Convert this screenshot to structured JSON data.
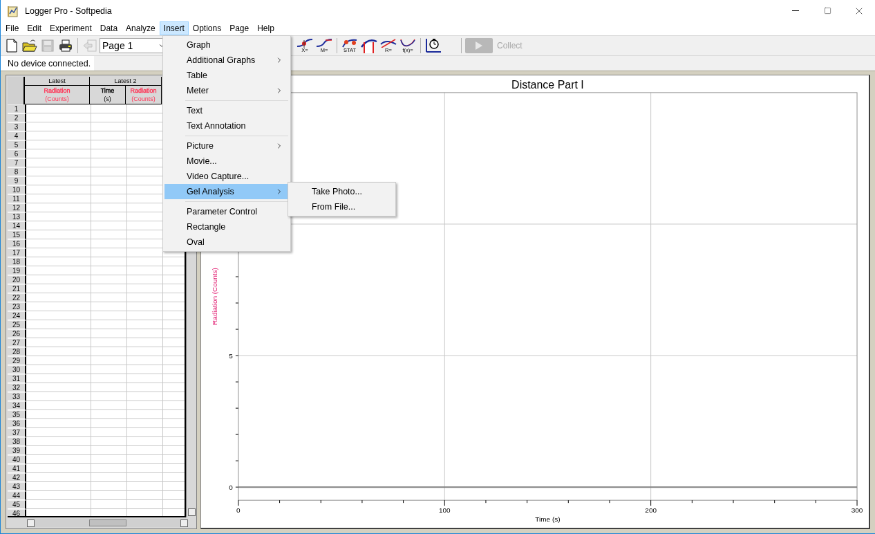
{
  "window": {
    "title": "Logger Pro - Softpedia"
  },
  "menu_bar": [
    {
      "label": "File",
      "selected": false
    },
    {
      "label": "Edit",
      "selected": false
    },
    {
      "label": "Experiment",
      "selected": false
    },
    {
      "label": "Data",
      "selected": false
    },
    {
      "label": "Analyze",
      "selected": false
    },
    {
      "label": "Insert",
      "selected": true
    },
    {
      "label": "Options",
      "selected": false
    },
    {
      "label": "Page",
      "selected": false
    },
    {
      "label": "Help",
      "selected": false
    }
  ],
  "open_menu": {
    "items": [
      {
        "kind": "item",
        "label": "Graph",
        "has_submenu": false,
        "selected": false
      },
      {
        "kind": "item",
        "label": "Additional Graphs",
        "has_submenu": true,
        "selected": false
      },
      {
        "kind": "item",
        "label": "Table",
        "has_submenu": false,
        "selected": false
      },
      {
        "kind": "item",
        "label": "Meter",
        "has_submenu": true,
        "selected": false
      },
      {
        "kind": "separator"
      },
      {
        "kind": "item",
        "label": "Text",
        "has_submenu": false,
        "selected": false
      },
      {
        "kind": "item",
        "label": "Text Annotation",
        "has_submenu": false,
        "selected": false
      },
      {
        "kind": "separator"
      },
      {
        "kind": "item",
        "label": "Picture",
        "has_submenu": true,
        "selected": false
      },
      {
        "kind": "item",
        "label": "Movie...",
        "has_submenu": false,
        "selected": false
      },
      {
        "kind": "item",
        "label": "Video Capture...",
        "has_submenu": false,
        "selected": false
      },
      {
        "kind": "item",
        "label": "Gel Analysis",
        "has_submenu": true,
        "selected": true,
        "submenu": [
          {
            "label": "Take Photo..."
          },
          {
            "label": "From File..."
          }
        ]
      },
      {
        "kind": "separator"
      },
      {
        "kind": "item",
        "label": "Parameter Control",
        "has_submenu": false,
        "selected": false
      },
      {
        "kind": "item",
        "label": "Rectangle",
        "has_submenu": false,
        "selected": false
      },
      {
        "kind": "item",
        "label": "Oval",
        "has_submenu": false,
        "selected": false
      }
    ]
  },
  "toolbar": {
    "left_buttons": [
      {
        "kind": "new",
        "disabled": false
      },
      {
        "kind": "open",
        "disabled": false
      },
      {
        "kind": "save",
        "disabled": true
      },
      {
        "kind": "print",
        "disabled": false
      },
      {
        "kind": "separator"
      },
      {
        "kind": "back",
        "disabled": true
      }
    ],
    "page_selector": {
      "value": "Page 1"
    },
    "right_buttons": [
      {
        "kind": "examine",
        "caption": "X=",
        "disabled": false
      },
      {
        "kind": "tangent",
        "caption": "M=",
        "disabled": false
      },
      {
        "kind": "separator"
      },
      {
        "kind": "stat",
        "caption": "STAT",
        "disabled": false
      },
      {
        "kind": "integral",
        "disabled": false
      },
      {
        "kind": "linear_fit",
        "caption": "R=",
        "disabled": false
      },
      {
        "kind": "curve_fit",
        "caption": "f(x)=",
        "disabled": false
      },
      {
        "kind": "separator"
      },
      {
        "kind": "timer",
        "disabled": false
      }
    ],
    "collect_button": {
      "label": "Collect",
      "disabled": true
    }
  },
  "status": "No device connected.",
  "table": {
    "groups": [
      {
        "label": "Latest",
        "columns": [
          {
            "name": "Radiation",
            "unit": "(Counts)",
            "color": "#ff3355"
          }
        ]
      },
      {
        "label": "Latest 2",
        "columns": [
          {
            "name": "Time",
            "unit": "(s)",
            "color": "#000000"
          },
          {
            "name": "Radiation",
            "unit": "(Counts)",
            "color": "#ff3355"
          }
        ]
      }
    ],
    "row_numbers": [
      "1",
      "2",
      "3",
      "4",
      "5",
      "6",
      "7",
      "8",
      "9",
      "10",
      "11",
      "12",
      "13",
      "14",
      "15",
      "16",
      "17",
      "18",
      "19",
      "20",
      "21",
      "22",
      "23",
      "24",
      "25",
      "26",
      "27",
      "28",
      "29",
      "30",
      "31",
      "32",
      "33",
      "34",
      "35",
      "36",
      "37",
      "38",
      "39",
      "40",
      "41",
      "42",
      "43",
      "44",
      "45",
      "46"
    ]
  },
  "graph": {
    "chart_data": {
      "type": "line",
      "title": "Distance Part I",
      "xlabel": "Time (s)",
      "ylabel": "Radiation (Counts)",
      "xlim": [
        0,
        300
      ],
      "ylim": [
        -0.5,
        15
      ],
      "xticks": [
        0,
        100,
        200,
        300
      ],
      "yticks": [
        0,
        5
      ],
      "grid": true
    }
  }
}
